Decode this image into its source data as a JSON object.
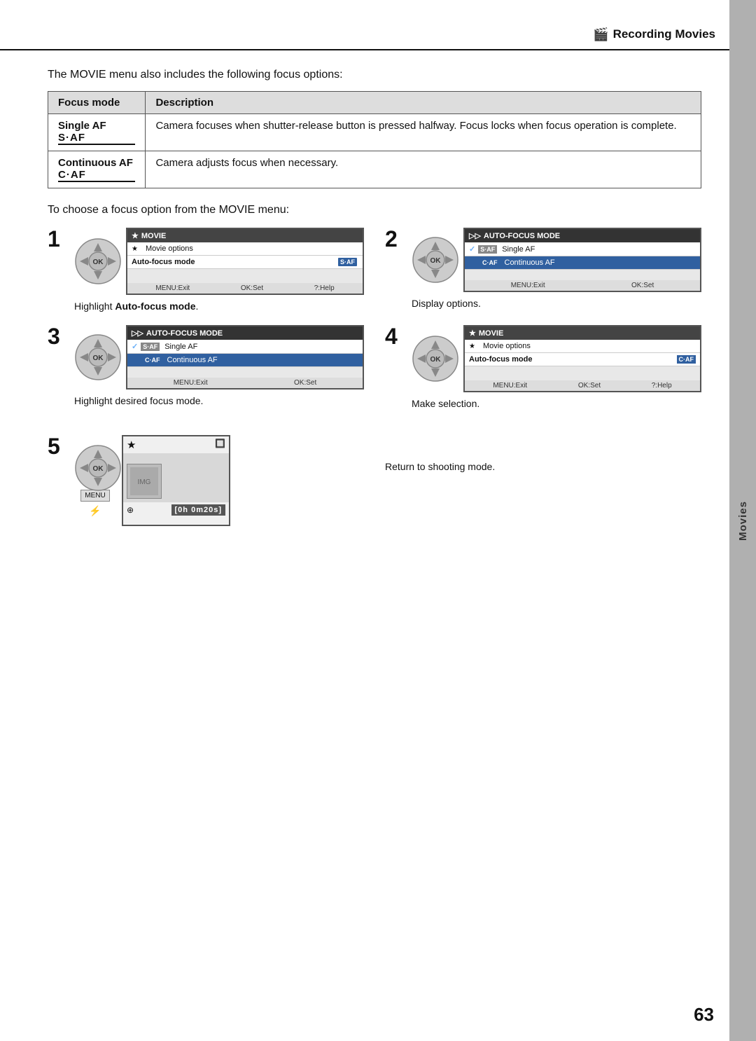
{
  "header": {
    "title": "Recording Movies",
    "icon": "🎬"
  },
  "side_tab": {
    "label": "Movies"
  },
  "intro": {
    "text": "The MOVIE menu also includes the following focus options:"
  },
  "table": {
    "headers": [
      "Focus mode",
      "Description"
    ],
    "rows": [
      {
        "mode_name": "Single AF",
        "mode_code": "S·AF",
        "description": "Camera focuses when shutter-release button is pressed halfway. Focus locks when focus operation is complete."
      },
      {
        "mode_name": "Continuous AF",
        "mode_code": "C·AF",
        "description": "Camera adjusts focus when necessary."
      }
    ]
  },
  "section": {
    "text": "To choose a focus option from the MOVIE menu:"
  },
  "steps": [
    {
      "number": "1",
      "caption": "Highlight Auto-focus mode.",
      "caption_bold": "Auto-focus mode"
    },
    {
      "number": "2",
      "caption": "Display options."
    },
    {
      "number": "3",
      "caption": "Highlight desired focus mode."
    },
    {
      "number": "4",
      "caption": "Make selection."
    },
    {
      "number": "5",
      "caption": "Return to shooting mode."
    }
  ],
  "screens": {
    "step1": {
      "header": "MOVIE",
      "rows": [
        {
          "label": "Movie options",
          "icon": "★",
          "badge": "",
          "highlight": false
        },
        {
          "label": "Auto-focus mode",
          "icon": "",
          "badge": "S·AF",
          "highlight": false
        }
      ],
      "footer": [
        "MENU:Exit",
        "OK:Set",
        "?:Help"
      ]
    },
    "step2": {
      "header": "AUTO-FOCUS MODE",
      "rows": [
        {
          "label": "Single AF",
          "icon": "S·AF",
          "check": true,
          "highlight": false
        },
        {
          "label": "Continuous AF",
          "icon": "C·AF",
          "check": false,
          "highlight": true
        }
      ],
      "footer": [
        "MENU:Exit",
        "OK:Set"
      ]
    },
    "step3": {
      "header": "AUTO-FOCUS MODE",
      "rows": [
        {
          "label": "Single AF",
          "icon": "S·AF",
          "check": true,
          "highlight": false
        },
        {
          "label": "Continuous AF",
          "icon": "C·AF",
          "check": false,
          "highlight": true
        }
      ],
      "footer": [
        "MENU:Exit",
        "OK:Set"
      ]
    },
    "step4": {
      "header": "MOVIE",
      "rows": [
        {
          "label": "Movie options",
          "icon": "★",
          "badge": "",
          "highlight": false
        },
        {
          "label": "Auto-focus mode",
          "icon": "",
          "badge": "C·AF",
          "highlight": false
        }
      ],
      "footer": [
        "MENU:Exit",
        "OK:Set",
        "?:Help"
      ]
    }
  },
  "page_number": "63",
  "shoot_screen": {
    "top_icon": "★",
    "corner_icon": "🔲",
    "bottom_icon": "⊕",
    "timer": "[0h 0m20s]"
  }
}
